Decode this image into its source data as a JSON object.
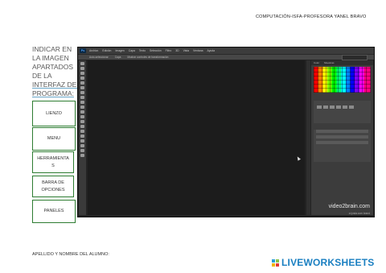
{
  "header": {
    "title": "COMPUTACIÓN-ISFA-PROFESORA YANEL BRAVO"
  },
  "instructions": {
    "lines": [
      "INDICAR EN",
      "LA IMAGEN",
      "APARTADOS",
      "DE LA",
      "INTERFAZ DEL",
      "PROGRAMA:"
    ]
  },
  "answer_boxes": [
    {
      "label": "LIENZO"
    },
    {
      "label": "MENU"
    },
    {
      "label": "HERRAMIENTAS"
    },
    {
      "label": "BARRA DE OPCIONES"
    },
    {
      "label": "PANELES"
    }
  ],
  "photoshop": {
    "logo": "Ps",
    "menu": [
      "Archivo",
      "Edición",
      "Imagen",
      "Capa",
      "Texto",
      "Selección",
      "Filtro",
      "3D",
      "Vista",
      "Ventana",
      "Ayuda"
    ],
    "options": [
      "Auto-seleccionar",
      "Capa",
      "Mostrar controles de transformación"
    ],
    "panel_tabs": [
      "Color",
      "Muestras"
    ],
    "watermark_title": "video2brain.com",
    "watermark_sub": "a lynda.com brand"
  },
  "footer": {
    "student_label": "APELLIDO Y NOMBRE DEL ALUMNO:"
  },
  "brand": {
    "name": "LIVEWORKSHEETS",
    "color": "#1a7fc1"
  }
}
